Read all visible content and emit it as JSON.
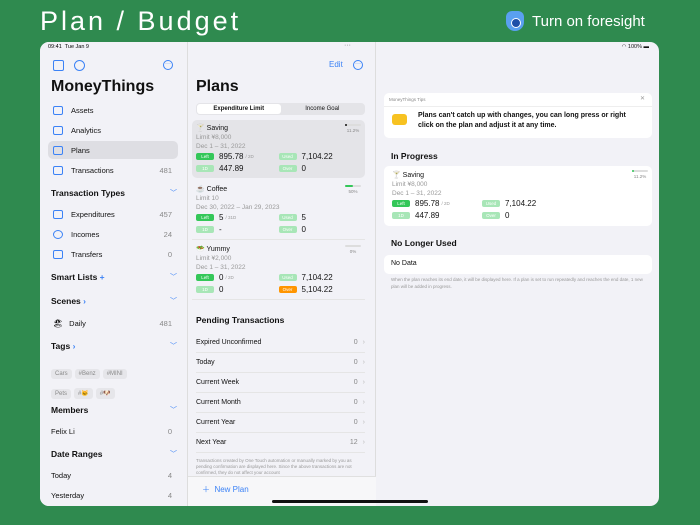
{
  "banner": {
    "title": "Plan / Budget",
    "foresight": "Turn on foresight"
  },
  "status": {
    "time": "09:41",
    "date": "Tue Jan 9",
    "battery": "100%"
  },
  "sidebar": {
    "app_title": "MoneyThings",
    "nav": [
      {
        "label": "Assets",
        "count": ""
      },
      {
        "label": "Analytics",
        "count": ""
      },
      {
        "label": "Plans",
        "count": ""
      },
      {
        "label": "Transactions",
        "count": "481"
      }
    ],
    "transaction_types": {
      "title": "Transaction Types",
      "items": [
        {
          "label": "Expenditures",
          "count": "457"
        },
        {
          "label": "Incomes",
          "count": "24"
        },
        {
          "label": "Transfers",
          "count": "0"
        }
      ]
    },
    "smart_lists": {
      "title": "Smart Lists",
      "add": "+"
    },
    "scenes": {
      "title": "Scenes",
      "items": [
        {
          "label": "Daily",
          "count": "481"
        }
      ]
    },
    "tags": {
      "title": "Tags",
      "row1": [
        "Cars",
        "#Benz",
        "#MINI"
      ],
      "row2": [
        "Pets",
        "#🐱",
        "#🐶"
      ]
    },
    "members": {
      "title": "Members",
      "items": [
        {
          "label": "Felix Li",
          "count": "0"
        }
      ]
    },
    "date_ranges": {
      "title": "Date Ranges",
      "items": [
        {
          "label": "Today",
          "count": "4"
        },
        {
          "label": "Yesterday",
          "count": "4"
        }
      ]
    }
  },
  "middle": {
    "edit": "Edit",
    "title": "Plans",
    "segments": [
      "Expenditure Limit",
      "Income Goal"
    ],
    "plans": [
      {
        "name": "Saving",
        "emoji": "🍸",
        "limit": "Limit ¥8,000",
        "dates": "Dec 1 – 31, 2022",
        "left": "895.78",
        "left_unit": "/ 2D",
        "used": "7,104.22",
        "per_day": "447.89",
        "over": "0",
        "percent": "11.2%",
        "progress": 11.2
      },
      {
        "name": "Coffee",
        "emoji": "☕",
        "limit": "Limit 10",
        "dates": "Dec 30, 2022 – Jan 29, 2023",
        "left": "5",
        "left_unit": "/ 31D",
        "used": "5",
        "per_day": "-",
        "over": "0",
        "percent": "50%",
        "progress": 50
      },
      {
        "name": "Yummy",
        "emoji": "🥗",
        "limit": "Limit ¥2,000",
        "dates": "Dec 1 – 31, 2022",
        "left": "0",
        "left_unit": "/ 2D",
        "used": "7,104.22",
        "per_day": "0",
        "over": "5,104.22",
        "percent": "0%",
        "progress": 0
      }
    ],
    "badges": {
      "left": "Left",
      "used": "Used",
      "per_day": "1D",
      "over": "Over"
    },
    "pending_title": "Pending Transactions",
    "pending": [
      {
        "label": "Expired Unconfirmed",
        "count": "0"
      },
      {
        "label": "Today",
        "count": "0"
      },
      {
        "label": "Current Week",
        "count": "0"
      },
      {
        "label": "Current Month",
        "count": "0"
      },
      {
        "label": "Current Year",
        "count": "0"
      },
      {
        "label": "Next Year",
        "count": "12"
      }
    ],
    "footer": "Transactions created by One Touch automation or manually marked by you as pending confirmation are displayed here. Since the above transactions are not confirmed, they do not affect your account",
    "new_plan": "New Plan"
  },
  "right": {
    "tips_title": "MoneyThings Tips",
    "tips_text": "Plans can't catch up with changes, you can long press or right click on the plan and adjust it at any time.",
    "in_progress": "In Progress",
    "no_longer": "No Longer Used",
    "no_data": "No Data",
    "note": "When the plan reaches its end date, it will be displayed here. If a plan is set to run repeatedly and reaches the end date, 1 new plan will be added in progress."
  },
  "colors": {
    "background": "#2f8a4f",
    "accent": "#3b82f6",
    "green": "#34c759",
    "orange": "#ff9500"
  }
}
